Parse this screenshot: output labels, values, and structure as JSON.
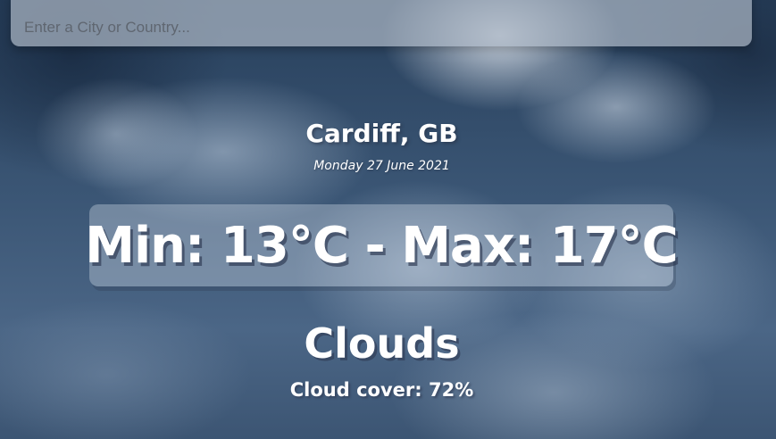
{
  "search": {
    "placeholder": "Enter a City or Country...",
    "value": ""
  },
  "location": {
    "city_country": "Cardiff, GB",
    "date": "Monday 27 June 2021"
  },
  "temperature": {
    "range_text": "Min: 13°C - Max: 17°C",
    "min": 13,
    "max": 17,
    "unit": "°C"
  },
  "weather": {
    "condition": "Clouds",
    "detail": "Cloud cover: 72%",
    "cloud_cover_percent": 72
  },
  "colors": {
    "text": "#ffffff",
    "search_bar": "#aab6c4",
    "background_sky": "#3b5675"
  }
}
